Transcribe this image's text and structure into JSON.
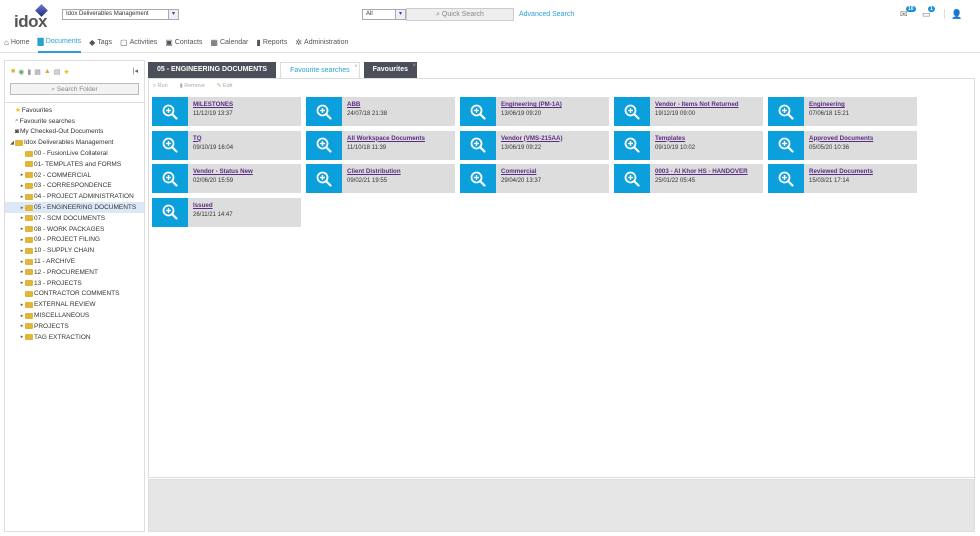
{
  "header": {
    "logo": "idox",
    "workspace": "Idox Deliverables Management",
    "scope": "All",
    "quick_search_placeholder": "Quick Search",
    "advanced_search": "Advanced Search",
    "notifications_count": "10",
    "messages_count": "1"
  },
  "nav": [
    {
      "label": "Home",
      "icon": "home-icon"
    },
    {
      "label": "Documents",
      "icon": "documents-icon",
      "active": true
    },
    {
      "label": "Tags",
      "icon": "tags-icon"
    },
    {
      "label": "Activities",
      "icon": "activities-icon"
    },
    {
      "label": "Contacts",
      "icon": "contacts-icon"
    },
    {
      "label": "Calendar",
      "icon": "calendar-icon"
    },
    {
      "label": "Reports",
      "icon": "reports-icon"
    },
    {
      "label": "Administration",
      "icon": "gear-icon"
    }
  ],
  "sidebar": {
    "search_placeholder": "Search Folder",
    "tree": [
      {
        "label": "Favourites",
        "icon": "star",
        "level": 0
      },
      {
        "label": "Favourite searches",
        "icon": "search",
        "level": 0
      },
      {
        "label": "My Checked-Out Documents",
        "icon": "checkout",
        "level": 0
      },
      {
        "label": "Idox Deliverables Management",
        "icon": "folder",
        "level": 0,
        "expanded": true
      },
      {
        "label": "00 - FusionLive Collateral",
        "level": 1
      },
      {
        "label": "01- TEMPLATES and FORMS",
        "level": 1
      },
      {
        "label": "02 - COMMERCIAL",
        "level": 1,
        "children": true
      },
      {
        "label": "03 - CORRESPONDENCE",
        "level": 1,
        "children": true
      },
      {
        "label": "04 - PROJECT ADMINISTRATION",
        "level": 1,
        "children": true
      },
      {
        "label": "05 - ENGINEERING DOCUMENTS",
        "level": 1,
        "children": true,
        "selected": true
      },
      {
        "label": "07 - SCM DOCUMENTS",
        "level": 1,
        "children": true
      },
      {
        "label": "08 - WORK PACKAGES",
        "level": 1,
        "children": true
      },
      {
        "label": "09 - PROJECT FILING",
        "level": 1,
        "children": true
      },
      {
        "label": "10 - SUPPLY CHAIN",
        "level": 1,
        "children": true
      },
      {
        "label": "11 - ARCHIVE",
        "level": 1,
        "children": true
      },
      {
        "label": "12 - PROCUREMENT",
        "level": 1,
        "children": true
      },
      {
        "label": "13 - PROJECTS",
        "level": 1,
        "children": true
      },
      {
        "label": "CONTRACTOR COMMENTS",
        "level": 1
      },
      {
        "label": "EXTERNAL REVIEW",
        "level": 1,
        "children": true
      },
      {
        "label": "MISCELLANEOUS",
        "level": 1,
        "children": true
      },
      {
        "label": "PROJECTS",
        "level": 1,
        "children": true
      },
      {
        "label": "TAG EXTRACTION",
        "level": 1,
        "children": true
      }
    ]
  },
  "tabs": [
    {
      "label": "05 - ENGINEERING DOCUMENTS"
    },
    {
      "label": "Favourite searches",
      "active": true,
      "closable": true
    },
    {
      "label": "Favourites",
      "closable": true
    }
  ],
  "toolbar": {
    "run": "Run",
    "remove": "Remove",
    "edit": "Edit"
  },
  "searches": [
    {
      "name": "MILESTONES",
      "date": "11/12/19 13:37"
    },
    {
      "name": "ABB",
      "date": "24/07/18 21:38"
    },
    {
      "name": "Engineering (PM-1A)",
      "date": "13/06/19 09:20"
    },
    {
      "name": "Vendor - Items Not Returned",
      "date": "19/12/19 09:00"
    },
    {
      "name": "Engineering",
      "date": "07/06/18 15:21"
    },
    {
      "name": "TQ",
      "date": "09/10/19 16:04"
    },
    {
      "name": "All Workspace Documents",
      "date": "11/10/18 11:39"
    },
    {
      "name": "Vendor (VMS-215AA)",
      "date": "13/06/19 09:22"
    },
    {
      "name": "Templates",
      "date": "09/10/19 10:02"
    },
    {
      "name": "Approved Documents",
      "date": "05/05/20 10:36"
    },
    {
      "name": "Vendor - Status New",
      "date": "02/06/20 15:59"
    },
    {
      "name": "Client Distribution",
      "date": "09/02/21 19:55"
    },
    {
      "name": "Commercial",
      "date": "29/04/20 13:37"
    },
    {
      "name": "0003 - Al Khor HS - HANDOVER",
      "date": "25/01/22 05:45"
    },
    {
      "name": "Reviewed Documents",
      "date": "15/03/21 17:14"
    },
    {
      "name": "Issued",
      "date": "26/11/21 14:47"
    }
  ],
  "colors": {
    "accent": "#2a9fd6",
    "tile": "#0ba0dc",
    "link": "#5a2d82",
    "tab_dark": "#4a4f5a"
  }
}
